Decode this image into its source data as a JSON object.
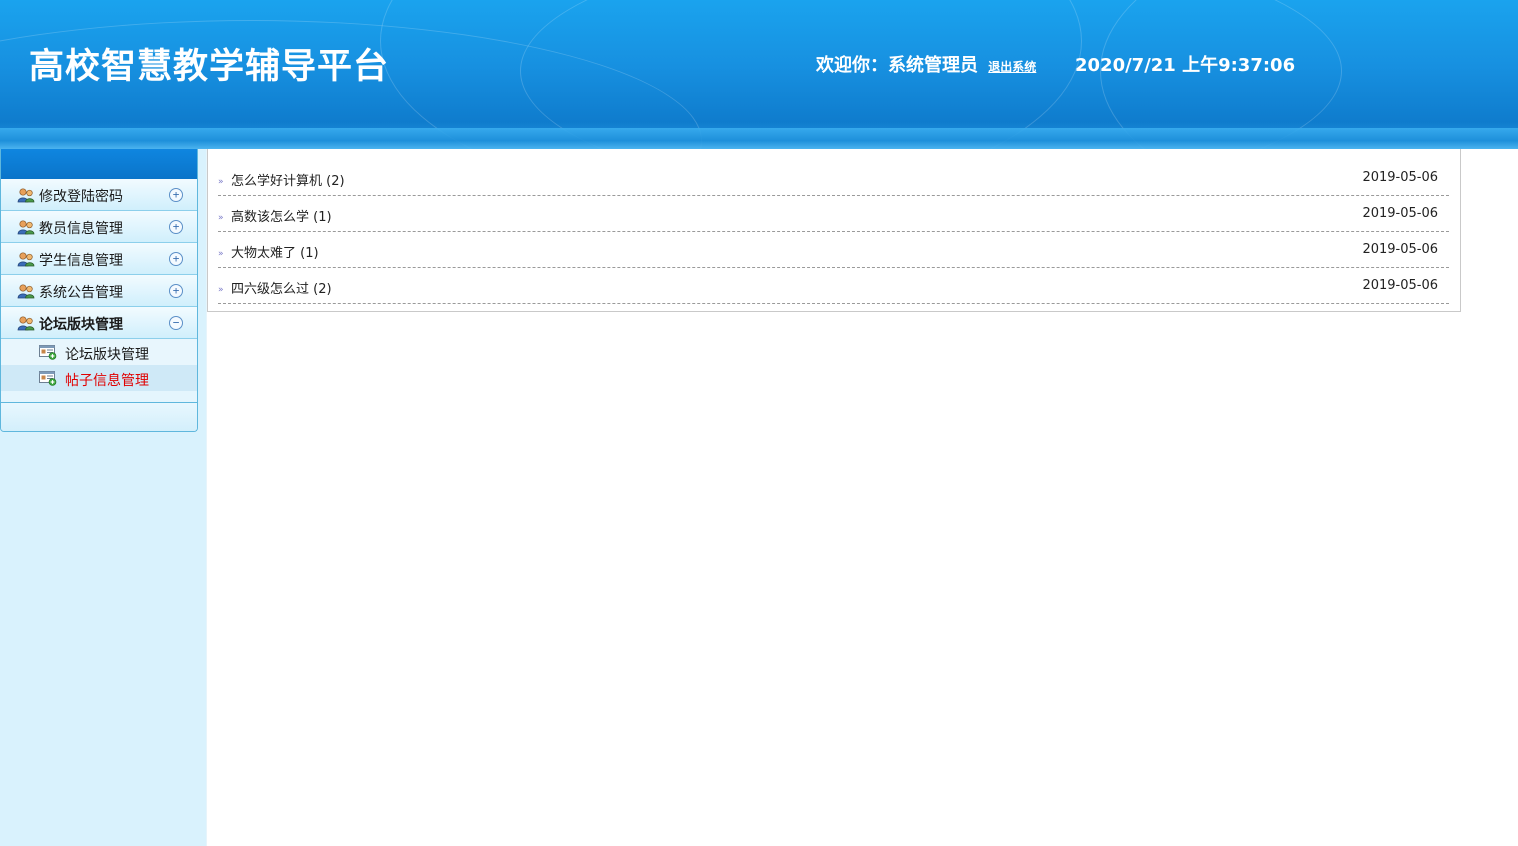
{
  "header": {
    "site_title": "高校智慧教学辅导平台",
    "welcome_text": "欢迎你：系统管理员",
    "logout_label": "退出系统",
    "datetime": "2020/7/21 上午9:37:06"
  },
  "sidebar": {
    "menu_items": [
      {
        "label": "修改登陆密码",
        "toggle": "+"
      },
      {
        "label": "教员信息管理",
        "toggle": "+"
      },
      {
        "label": "学生信息管理",
        "toggle": "+"
      },
      {
        "label": "系统公告管理",
        "toggle": "+"
      },
      {
        "label": "论坛版块管理",
        "toggle": "−"
      }
    ],
    "sub_items": [
      {
        "label": "论坛版块管理"
      },
      {
        "label": "帖子信息管理"
      }
    ]
  },
  "posts": [
    {
      "title": "怎么学好计算机 (2)",
      "date": "2019-05-06"
    },
    {
      "title": "高数该怎么学 (1)",
      "date": "2019-05-06"
    },
    {
      "title": "大物太难了 (1)",
      "date": "2019-05-06"
    },
    {
      "title": "四六级怎么过 (2)",
      "date": "2019-05-06"
    }
  ],
  "colors": {
    "header_blue": "#1790e0",
    "active_link": "#e00000",
    "sidebar_bg": "#d9f2fd"
  },
  "icons": {
    "menu_item": "users-icon",
    "sub_item": "document-add-icon",
    "post_bullet": "double-arrow-icon"
  }
}
